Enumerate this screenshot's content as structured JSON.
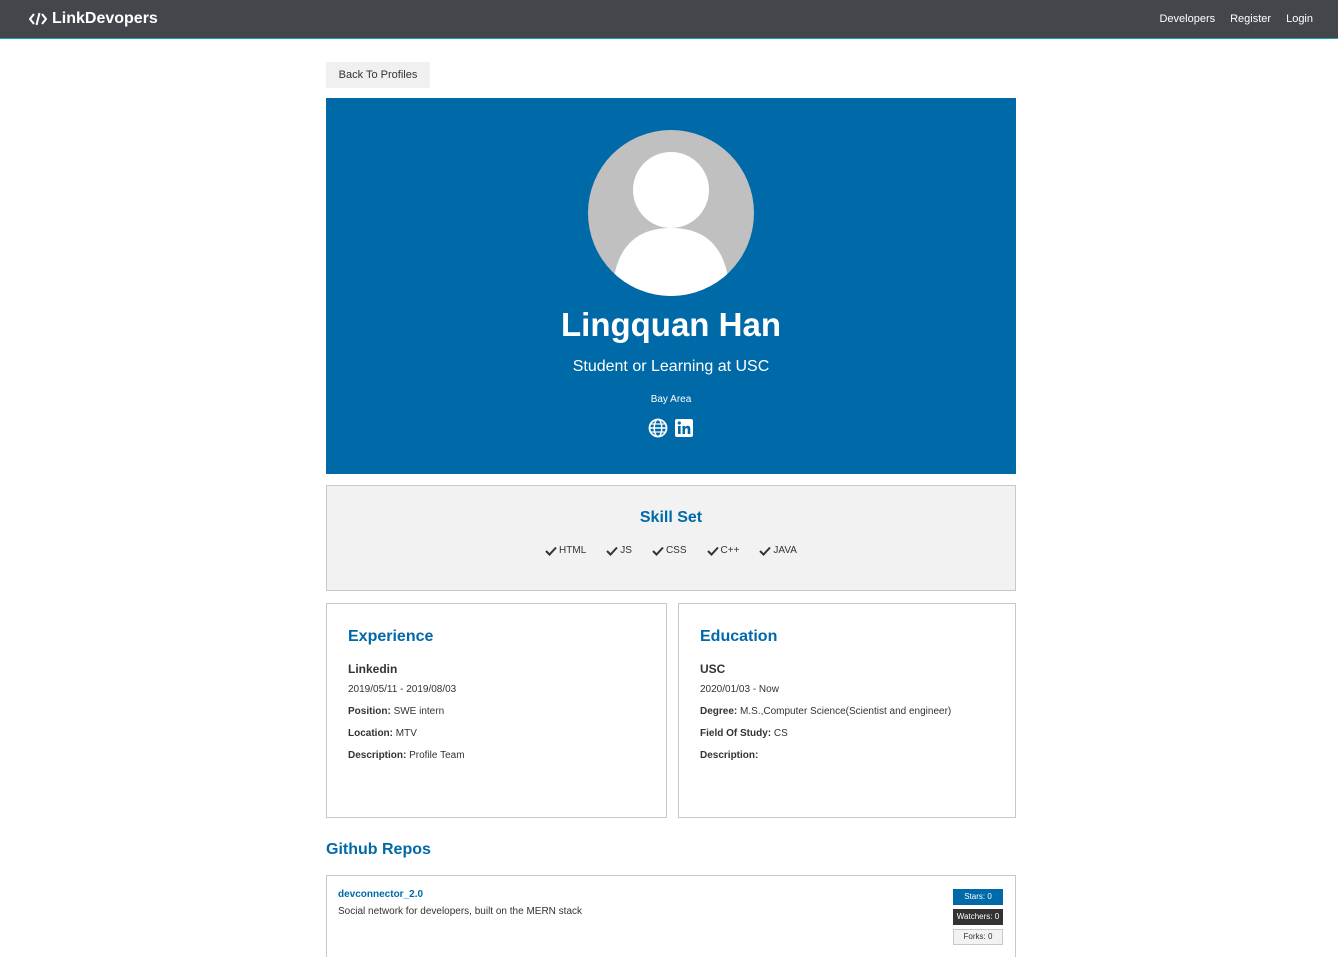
{
  "navbar": {
    "brand": "LinkDevopers",
    "links": [
      "Developers",
      "Register",
      "Login"
    ]
  },
  "back_button": "Back To Profiles",
  "profile": {
    "name": "Lingquan Han",
    "status": "Student or Learning at USC",
    "location": "Bay Area",
    "social_icons": [
      "globe-icon",
      "linkedin-icon"
    ]
  },
  "skills": {
    "title": "Skill Set",
    "items": [
      "HTML",
      "JS",
      "CSS",
      "C++",
      "JAVA"
    ]
  },
  "experience": {
    "title": "Experience",
    "entries": [
      {
        "company": "Linkedin",
        "dates": "2019/05/11 - 2019/08/03",
        "position_label": "Position:",
        "position": "SWE intern",
        "location_label": "Location:",
        "location": "MTV",
        "description_label": "Description:",
        "description": "Profile Team"
      }
    ]
  },
  "education": {
    "title": "Education",
    "entries": [
      {
        "school": "USC",
        "dates": "2020/01/03 - Now",
        "degree_label": "Degree:",
        "degree": "M.S.,Computer Science(Scientist and engineer)",
        "field_label": "Field Of Study:",
        "field": "CS",
        "description_label": "Description:",
        "description": ""
      }
    ]
  },
  "github": {
    "title": "Github Repos",
    "repos": [
      {
        "name": "devconnector_2.0",
        "description": "Social network for developers, built on the MERN stack",
        "stars": "Stars: 0",
        "watchers": "Watchers: 0",
        "forks": "Forks: 0"
      }
    ]
  },
  "colors": {
    "navbar": "#43464b",
    "primary": "#0069a8",
    "light": "#f2f2f2",
    "dark": "#333333"
  }
}
